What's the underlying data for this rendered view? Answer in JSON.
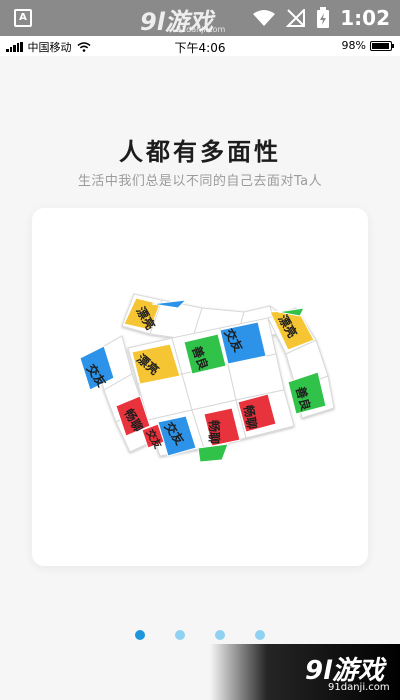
{
  "android_status": {
    "app_icon": "A",
    "watermark": "9l游戏",
    "watermark_url": "91danji.com",
    "time": "1:02",
    "icons": [
      "wifi-icon",
      "no-signal-icon",
      "battery-charging-icon"
    ]
  },
  "ios_status": {
    "carrier": "中国移动",
    "time": "下午4:06",
    "battery": "98%",
    "battery_level": 0.98
  },
  "main": {
    "title": "人都有多面性",
    "subtitle": "生活中我们总是以不同的自己去面对Ta人"
  },
  "cube_labels": {
    "c1": "漂亮",
    "c2": "漂亮",
    "c3": "漂亮",
    "c4": "交友",
    "c5": "善良",
    "c6": "交友",
    "c7": "畅聊",
    "c8": "交友",
    "c9": "畅聊",
    "c10": "畅聊",
    "c11": "善良",
    "c12": "交友"
  },
  "pager": {
    "count": 4,
    "active_index": 0
  },
  "corner_watermark": {
    "text": "9l游戏",
    "url": "91danji.com"
  },
  "colors": {
    "yellow": "#f5c534",
    "green": "#31c24a",
    "blue": "#2c93e8",
    "red": "#e8323c",
    "active_dot": "#1e96dc",
    "inactive_dot": "#8fd1f1"
  }
}
